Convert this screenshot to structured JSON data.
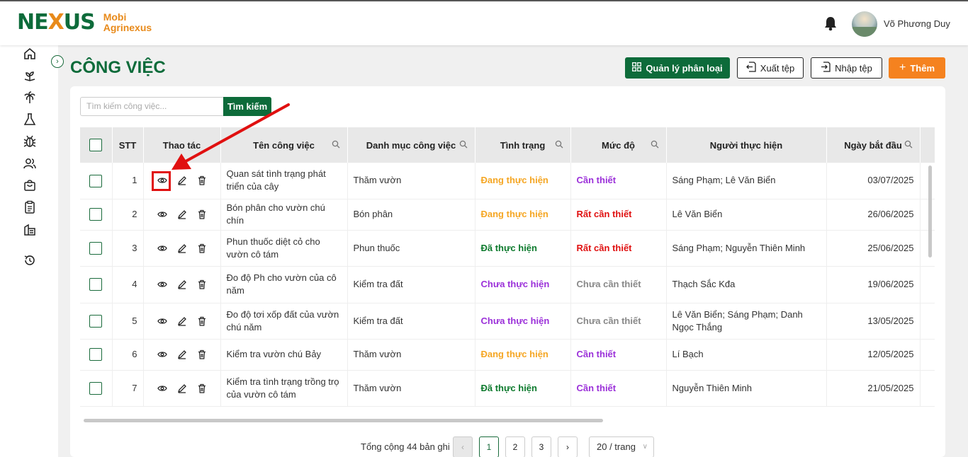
{
  "brand": {
    "logo_left": "NE",
    "logo_x": "X",
    "logo_right": "US",
    "line1": "Mobi",
    "line2": "Agrinexus"
  },
  "header": {
    "user_name": "Võ Phương Duy"
  },
  "page": {
    "title": "CÔNG VIỆC"
  },
  "toolbar": {
    "manage_label": "Quản lý phân loại",
    "export_label": "Xuất tệp",
    "import_label": "Nhập tệp",
    "add_label": "Thêm"
  },
  "search": {
    "placeholder": "Tìm kiếm công việc...",
    "button_label": "Tìm kiếm"
  },
  "table": {
    "headers": {
      "stt": "STT",
      "actions": "Thao tác",
      "name": "Tên công việc",
      "category": "Danh mục công việc",
      "status": "Tình trạng",
      "level": "Mức độ",
      "assignee": "Người thực hiện",
      "start_date": "Ngày bắt đầu"
    },
    "rows": [
      {
        "stt": "1",
        "name": "Quan sát tình trạng phát triển của cây",
        "category": "Thăm vườn",
        "status": "Đang thực hiện",
        "status_type": "progress",
        "level": "Cần thiết",
        "level_type": "need",
        "assignee": "Sáng Phạm; Lê  Văn Biển",
        "date": "03/07/2025"
      },
      {
        "stt": "2",
        "name": "Bón phân cho vườn chú chín",
        "category": "Bón phân",
        "status": "Đang thực hiện",
        "status_type": "progress",
        "level": "Rất cần thiết",
        "level_type": "very",
        "assignee": "Lê  Văn Biển",
        "date": "26/06/2025"
      },
      {
        "stt": "3",
        "name": "Phun thuốc diệt cỏ cho vườn cô tám",
        "category": "Phun thuốc",
        "status": "Đã thực hiện",
        "status_type": "done",
        "level": "Rất cần thiết",
        "level_type": "very",
        "assignee": "Sáng Phạm; Nguyễn  Thiên Minh",
        "date": "25/06/2025"
      },
      {
        "stt": "4",
        "name": "Đo độ Ph cho vườn của cô năm",
        "category": "Kiểm tra đất",
        "status": "Chưa thực hiện",
        "status_type": "todo",
        "level": "Chưa cần thiết",
        "level_type": "not",
        "assignee": "Thạch Sắc Kđa",
        "date": "19/06/2025"
      },
      {
        "stt": "5",
        "name": "Đo độ tơi xốp đất của vườn chú năm",
        "category": "Kiểm tra đất",
        "status": "Chưa thực hiện",
        "status_type": "todo",
        "level": "Chưa cần thiết",
        "level_type": "not",
        "assignee": "Lê  Văn Biển; Sáng Phạm; Danh  Ngọc Thắng",
        "date": "13/05/2025"
      },
      {
        "stt": "6",
        "name": "Kiểm tra vườn chú Bảy",
        "category": "Thăm vườn",
        "status": "Đang thực hiện",
        "status_type": "progress",
        "level": "Cần thiết",
        "level_type": "need",
        "assignee": "Lí  Bạch",
        "date": "12/05/2025"
      },
      {
        "stt": "7",
        "name": "Kiểm tra tình trạng trồng trọ của vườn cô tám",
        "category": "Thăm vườn",
        "status": "Đã thực hiện",
        "status_type": "done",
        "level": "Cần thiết",
        "level_type": "need",
        "assignee": "Nguyễn  Thiên Minh",
        "date": "21/05/2025"
      }
    ]
  },
  "pagination": {
    "total": "Tổng cộng 44 bản ghi",
    "pages": [
      "1",
      "2",
      "3"
    ],
    "current_page": "1",
    "page_size": "20 / trang"
  },
  "colors": {
    "brand_green": "#0d6b3a",
    "brand_orange": "#f5821f",
    "status_progress": "#f5a623",
    "status_done": "#0d7a2d",
    "status_todo": "#9b30d9",
    "level_very": "#e01010",
    "level_not": "#888888",
    "annotation_red": "#e01010"
  }
}
